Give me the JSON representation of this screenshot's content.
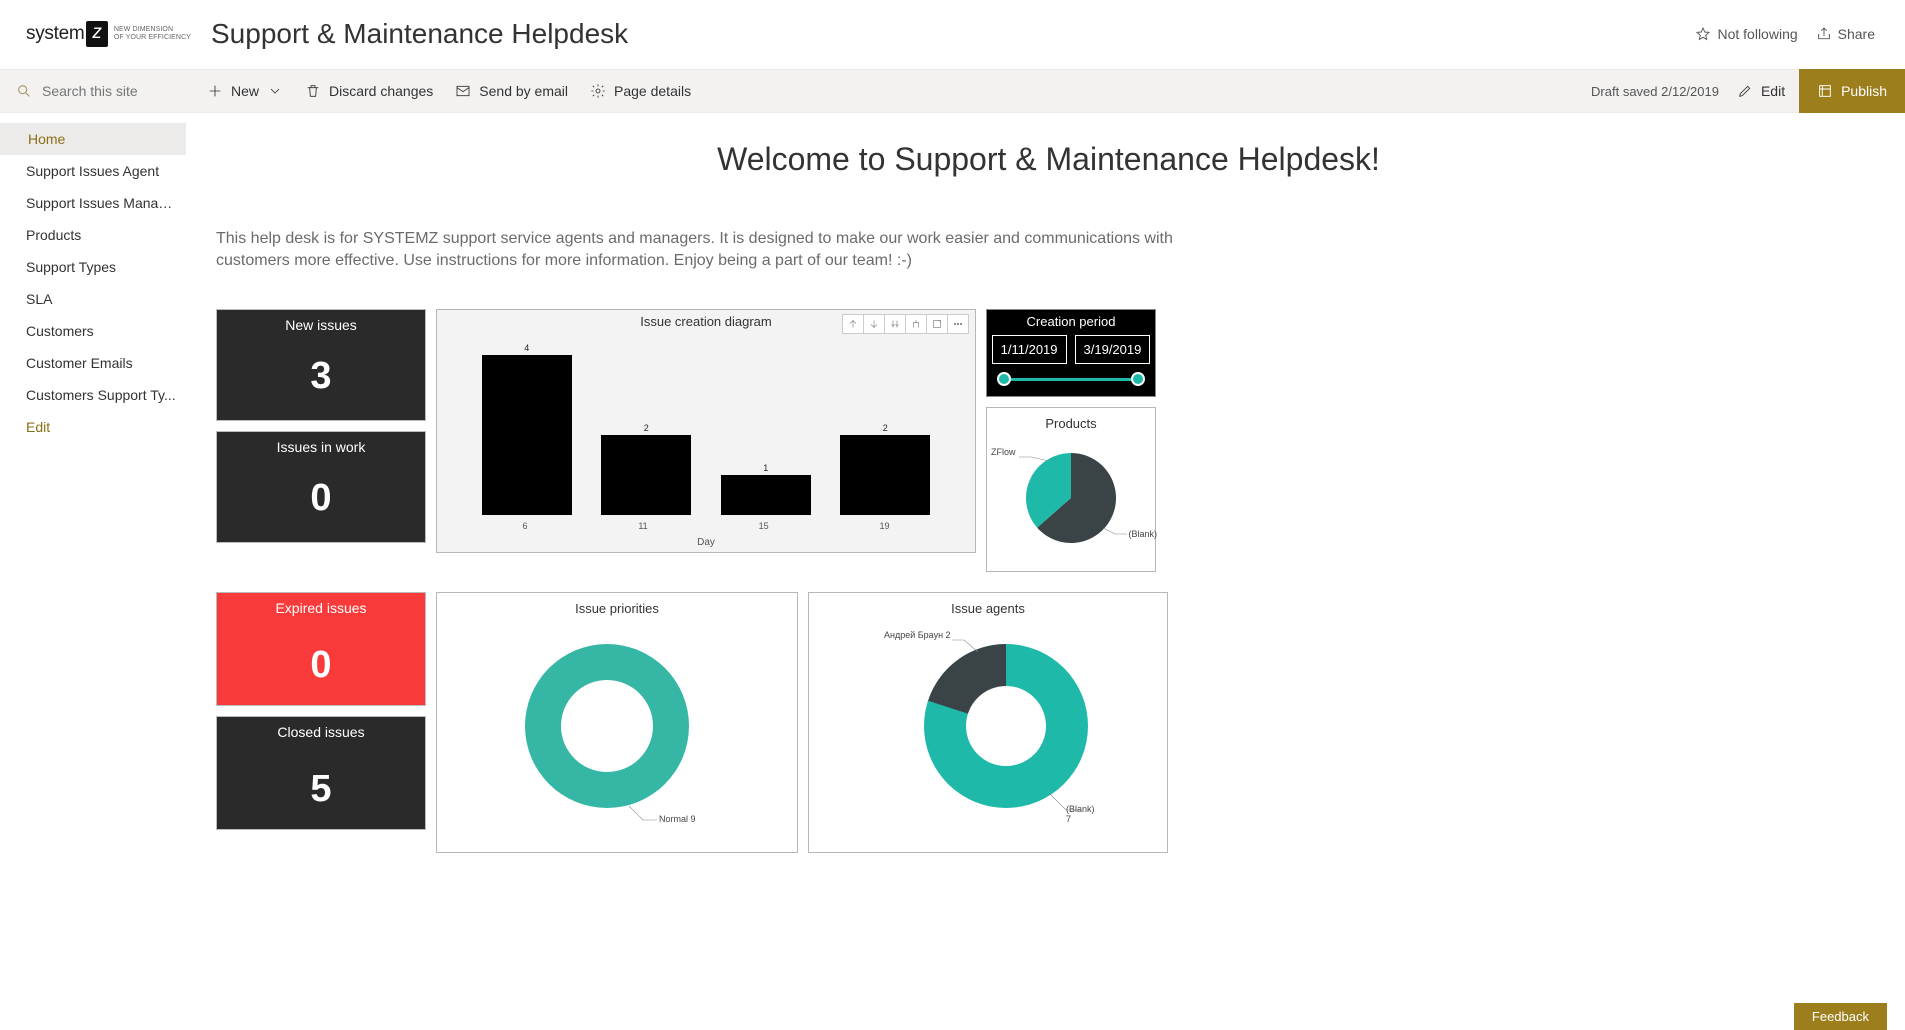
{
  "header": {
    "logo_word": "system",
    "logo_letter": "z",
    "logo_tagline1": "NEW DIMENSION",
    "logo_tagline2": "OF YOUR EFFICIENCY",
    "site_title": "Support & Maintenance Helpdesk",
    "not_following": "Not following",
    "share": "Share"
  },
  "commandbar": {
    "search_placeholder": "Search this site",
    "new": "New",
    "discard": "Discard changes",
    "send_email": "Send by email",
    "page_details": "Page details",
    "draft_status": "Draft saved 2/12/2019",
    "edit": "Edit",
    "publish": "Publish"
  },
  "sidebar": {
    "items": [
      {
        "label": "Home",
        "active": true
      },
      {
        "label": "Support Issues Agent"
      },
      {
        "label": "Support Issues Manag..."
      },
      {
        "label": "Products"
      },
      {
        "label": "Support Types"
      },
      {
        "label": "SLA"
      },
      {
        "label": "Customers"
      },
      {
        "label": "Customer Emails"
      },
      {
        "label": "Customers Support Ty..."
      }
    ],
    "edit": "Edit"
  },
  "page": {
    "title": "Welcome to Support & Maintenance Helpdesk!",
    "description": "This help desk is for SYSTEMZ support service agents and managers. It is designed to make our work easier and communications with customers more effective. Use instructions for more information. Enjoy being a part of our team! :-)"
  },
  "kpis": {
    "new_issues": {
      "title": "New issues",
      "value": "3"
    },
    "in_work": {
      "title": "Issues in work",
      "value": "0"
    },
    "expired": {
      "title": "Expired issues",
      "value": "0"
    },
    "closed": {
      "title": "Closed issues",
      "value": "5"
    }
  },
  "bar_chart": {
    "title": "Issue creation diagram",
    "xlabel": "Day"
  },
  "period": {
    "title": "Creation period",
    "from": "1/11/2019",
    "to": "3/19/2019"
  },
  "products": {
    "title": "Products",
    "label1": "ZFlow",
    "label2": "(Blank)"
  },
  "priorities": {
    "title": "Issue priorities",
    "label": "Normal 9"
  },
  "agents": {
    "title": "Issue agents",
    "label1": "Андрей Браун 2",
    "label2": "(Blank) 7"
  },
  "feedback": "Feedback",
  "chart_data": [
    {
      "type": "bar",
      "title": "Issue creation diagram",
      "xlabel": "Day",
      "categories": [
        "6",
        "11",
        "15",
        "19"
      ],
      "values": [
        4,
        2,
        1,
        2
      ]
    },
    {
      "type": "pie",
      "title": "Products",
      "series": [
        {
          "name": "ZFlow",
          "value": 40
        },
        {
          "name": "(Blank)",
          "value": 60
        }
      ]
    },
    {
      "type": "pie",
      "title": "Issue priorities",
      "series": [
        {
          "name": "Normal",
          "value": 9
        }
      ]
    },
    {
      "type": "pie",
      "title": "Issue agents",
      "series": [
        {
          "name": "Андрей Браун",
          "value": 2
        },
        {
          "name": "(Blank)",
          "value": 7
        }
      ]
    }
  ]
}
